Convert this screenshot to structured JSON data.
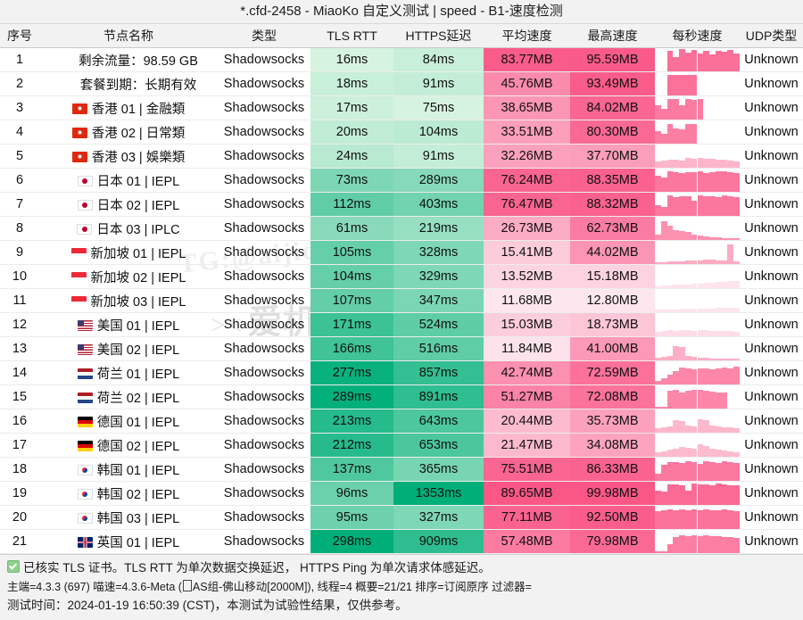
{
  "window": {
    "title": "*.cfd-2458 - MiaoKo 自定义测试 | speed - B1-速度检测"
  },
  "watermarks": {
    "text": "TG:@aijichang",
    "logo_mark": "><",
    "logo_text": "爱机场"
  },
  "table": {
    "columns": [
      {
        "key": "index",
        "label": "序号"
      },
      {
        "key": "name",
        "label": "节点名称"
      },
      {
        "key": "type",
        "label": "类型"
      },
      {
        "key": "tls",
        "label": "TLS RTT"
      },
      {
        "key": "https",
        "label": "HTTPS延迟"
      },
      {
        "key": "avg",
        "label": "平均速度"
      },
      {
        "key": "max",
        "label": "最高速度"
      },
      {
        "key": "spark",
        "label": "每秒速度"
      },
      {
        "key": "udp",
        "label": "UDP类型"
      }
    ],
    "rows": [
      {
        "index": "1",
        "flag": "none",
        "name": "剩余流量：98.59 GB",
        "type": "Shadowsocks",
        "tls": "16ms",
        "https": "84ms",
        "avg": "83.77MB",
        "max": "95.59MB",
        "udp": "Unknown",
        "tls_v": 16,
        "https_v": 84,
        "avg_v": 83.77,
        "max_v": 95.59,
        "spark": [
          0,
          0,
          88,
          62,
          95,
          80,
          92,
          78,
          88,
          72,
          90,
          85,
          92,
          78
        ]
      },
      {
        "index": "2",
        "flag": "none",
        "name": "套餐到期：长期有效",
        "type": "Shadowsocks",
        "tls": "18ms",
        "https": "91ms",
        "avg": "45.76MB",
        "max": "93.49MB",
        "udp": "Unknown",
        "tls_v": 18,
        "https_v": 91,
        "avg_v": 45.76,
        "max_v": 93.49,
        "spark": [
          0,
          0,
          90,
          90,
          90,
          90,
          90,
          0,
          0,
          0,
          0,
          0,
          0,
          0
        ]
      },
      {
        "index": "3",
        "flag": "hk",
        "name": "香港 01 | 金融類",
        "type": "Shadowsocks",
        "tls": "17ms",
        "https": "75ms",
        "avg": "38.65MB",
        "max": "84.02MB",
        "udp": "Unknown",
        "tls_v": 17,
        "https_v": 75,
        "avg_v": 38.65,
        "max_v": 84.02,
        "spark": [
          60,
          45,
          90,
          88,
          60,
          88,
          86,
          88,
          0,
          0,
          0,
          0,
          0,
          0
        ]
      },
      {
        "index": "4",
        "flag": "hk",
        "name": "香港 02 | 日常類",
        "type": "Shadowsocks",
        "tls": "20ms",
        "https": "104ms",
        "avg": "33.51MB",
        "max": "80.30MB",
        "udp": "Unknown",
        "tls_v": 20,
        "https_v": 104,
        "avg_v": 33.51,
        "max_v": 80.3,
        "spark": [
          55,
          42,
          86,
          64,
          60,
          86,
          84,
          0,
          0,
          0,
          0,
          0,
          0,
          0
        ]
      },
      {
        "index": "5",
        "flag": "hk",
        "name": "香港 03 | 娛樂類",
        "type": "Shadowsocks",
        "tls": "24ms",
        "https": "91ms",
        "avg": "32.26MB",
        "max": "37.70MB",
        "udp": "Unknown",
        "tls_v": 24,
        "https_v": 91,
        "avg_v": 32.26,
        "max_v": 37.7,
        "spark": [
          28,
          30,
          36,
          34,
          32,
          44,
          40,
          42,
          38,
          40,
          36,
          34,
          30,
          26
        ]
      },
      {
        "index": "6",
        "flag": "jp",
        "name": "日本 01 | IEPL",
        "type": "Shadowsocks",
        "tls": "73ms",
        "https": "289ms",
        "avg": "76.24MB",
        "max": "88.35MB",
        "udp": "Unknown",
        "tls_v": 73,
        "https_v": 289,
        "avg_v": 76.24,
        "max_v": 88.35,
        "spark": [
          68,
          62,
          88,
          84,
          80,
          86,
          84,
          88,
          82,
          86,
          90,
          88,
          84,
          80
        ]
      },
      {
        "index": "7",
        "flag": "jp",
        "name": "日本 02 | IEPL",
        "type": "Shadowsocks",
        "tls": "112ms",
        "https": "403ms",
        "avg": "76.47MB",
        "max": "88.32MB",
        "udp": "Unknown",
        "tls_v": 112,
        "https_v": 403,
        "avg_v": 76.47,
        "max_v": 88.32,
        "spark": [
          46,
          40,
          88,
          80,
          84,
          86,
          64,
          88,
          84,
          86,
          82,
          88,
          84,
          80
        ]
      },
      {
        "index": "8",
        "flag": "jp",
        "name": "日本 03 | IPLC",
        "type": "Shadowsocks",
        "tls": "61ms",
        "https": "219ms",
        "avg": "26.73MB",
        "max": "62.73MB",
        "udp": "Unknown",
        "tls_v": 61,
        "https_v": 219,
        "avg_v": 26.73,
        "max_v": 62.73,
        "spark": [
          22,
          80,
          62,
          42,
          38,
          34,
          24,
          20,
          16,
          12,
          10,
          8,
          6,
          4
        ]
      },
      {
        "index": "9",
        "flag": "sg",
        "name": "新加坡 01 | IEPL",
        "type": "Shadowsocks",
        "tls": "105ms",
        "https": "328ms",
        "avg": "15.41MB",
        "max": "44.02MB",
        "udp": "Unknown",
        "tls_v": 105,
        "https_v": 328,
        "avg_v": 15.41,
        "max_v": 44.02,
        "spark": [
          8,
          8,
          10,
          12,
          12,
          14,
          16,
          16,
          18,
          18,
          16,
          14,
          86,
          10
        ]
      },
      {
        "index": "10",
        "flag": "sg",
        "name": "新加坡 02 | IEPL",
        "type": "Shadowsocks",
        "tls": "104ms",
        "https": "329ms",
        "avg": "13.52MB",
        "max": "15.18MB",
        "udp": "Unknown",
        "tls_v": 104,
        "https_v": 329,
        "avg_v": 13.52,
        "max_v": 15.18,
        "spark": [
          8,
          10,
          12,
          14,
          16,
          16,
          18,
          20,
          22,
          24,
          26,
          28,
          30,
          30
        ]
      },
      {
        "index": "11",
        "flag": "sg",
        "name": "新加坡 03 | IEPL",
        "type": "Shadowsocks",
        "tls": "107ms",
        "https": "347ms",
        "avg": "11.68MB",
        "max": "12.80MB",
        "udp": "Unknown",
        "tls_v": 107,
        "https_v": 347,
        "avg_v": 11.68,
        "max_v": 12.8,
        "spark": [
          10,
          10,
          12,
          12,
          14,
          14,
          14,
          16,
          16,
          16,
          18,
          18,
          18,
          18
        ]
      },
      {
        "index": "12",
        "flag": "us",
        "name": "美国 01 | IEPL",
        "type": "Shadowsocks",
        "tls": "171ms",
        "https": "524ms",
        "avg": "15.03MB",
        "max": "18.73MB",
        "udp": "Unknown",
        "tls_v": 171,
        "https_v": 524,
        "avg_v": 15.03,
        "max_v": 18.73,
        "spark": [
          18,
          22,
          26,
          24,
          26,
          26,
          24,
          26,
          26,
          24,
          24,
          22,
          22,
          20
        ]
      },
      {
        "index": "13",
        "flag": "us",
        "name": "美国 02 | IEPL",
        "type": "Shadowsocks",
        "tls": "166ms",
        "https": "516ms",
        "avg": "11.84MB",
        "max": "41.00MB",
        "udp": "Unknown",
        "tls_v": 166,
        "https_v": 516,
        "avg_v": 11.84,
        "max_v": 41.0,
        "spark": [
          10,
          14,
          20,
          60,
          58,
          20,
          14,
          12,
          10,
          8,
          8,
          6,
          6,
          6
        ]
      },
      {
        "index": "14",
        "flag": "nl",
        "name": "荷兰 01 | IEPL",
        "type": "Shadowsocks",
        "tls": "277ms",
        "https": "857ms",
        "avg": "42.74MB",
        "max": "72.59MB",
        "udp": "Unknown",
        "tls_v": 277,
        "https_v": 857,
        "avg_v": 42.74,
        "max_v": 72.59,
        "spark": [
          16,
          26,
          44,
          56,
          72,
          70,
          66,
          70,
          68,
          66,
          70,
          74,
          70,
          78
        ]
      },
      {
        "index": "15",
        "flag": "nl",
        "name": "荷兰 02 | IEPL",
        "type": "Shadowsocks",
        "tls": "289ms",
        "https": "891ms",
        "avg": "51.27MB",
        "max": "72.08MB",
        "udp": "Unknown",
        "tls_v": 289,
        "https_v": 891,
        "avg_v": 51.27,
        "max_v": 72.08,
        "spark": [
          4,
          6,
          78,
          82,
          70,
          76,
          82,
          80,
          76,
          72,
          70,
          68,
          0,
          0
        ]
      },
      {
        "index": "16",
        "flag": "de",
        "name": "德国 01 | IEPL",
        "type": "Shadowsocks",
        "tls": "213ms",
        "https": "643ms",
        "avg": "20.44MB",
        "max": "35.73MB",
        "udp": "Unknown",
        "tls_v": 213,
        "https_v": 643,
        "avg_v": 20.44,
        "max_v": 35.73,
        "spark": [
          18,
          22,
          26,
          54,
          50,
          30,
          28,
          56,
          52,
          30,
          26,
          24,
          22,
          18
        ]
      },
      {
        "index": "17",
        "flag": "de",
        "name": "德国 02 | IEPL",
        "type": "Shadowsocks",
        "tls": "212ms",
        "https": "653ms",
        "avg": "21.47MB",
        "max": "34.08MB",
        "udp": "Unknown",
        "tls_v": 212,
        "https_v": 653,
        "avg_v": 21.47,
        "max_v": 34.08,
        "spark": [
          20,
          24,
          30,
          34,
          44,
          38,
          34,
          52,
          48,
          34,
          30,
          28,
          24,
          20
        ]
      },
      {
        "index": "18",
        "flag": "kr",
        "name": "韩国 01 | IEPL",
        "type": "Shadowsocks",
        "tls": "137ms",
        "https": "365ms",
        "avg": "75.51MB",
        "max": "86.33MB",
        "udp": "Unknown",
        "tls_v": 137,
        "https_v": 365,
        "avg_v": 75.51,
        "max_v": 86.33,
        "spark": [
          30,
          70,
          82,
          80,
          78,
          84,
          80,
          72,
          86,
          82,
          78,
          84,
          80,
          76
        ]
      },
      {
        "index": "19",
        "flag": "kr",
        "name": "韩国 02 | IEPL",
        "type": "Shadowsocks",
        "tls": "96ms",
        "https": "1353ms",
        "avg": "89.65MB",
        "max": "99.98MB",
        "udp": "Unknown",
        "tls_v": 96,
        "https_v": 1353,
        "avg_v": 89.65,
        "max_v": 99.98,
        "spark": [
          62,
          56,
          88,
          90,
          86,
          62,
          92,
          88,
          90,
          86,
          92,
          88,
          86,
          84
        ]
      },
      {
        "index": "20",
        "flag": "kr",
        "name": "韩国 03 | IEPL",
        "type": "Shadowsocks",
        "tls": "95ms",
        "https": "327ms",
        "avg": "77.11MB",
        "max": "92.50MB",
        "udp": "Unknown",
        "tls_v": 95,
        "https_v": 327,
        "avg_v": 77.11,
        "max_v": 92.5,
        "spark": [
          76,
          80,
          84,
          82,
          86,
          82,
          84,
          80,
          86,
          82,
          80,
          84,
          82,
          78
        ]
      },
      {
        "index": "21",
        "flag": "gb",
        "name": "英国 01 | IEPL",
        "type": "Shadowsocks",
        "tls": "298ms",
        "https": "909ms",
        "avg": "57.48MB",
        "max": "79.98MB",
        "udp": "Unknown",
        "tls_v": 298,
        "https_v": 909,
        "avg_v": 57.48,
        "max_v": 79.98,
        "spark": [
          4,
          4,
          40,
          68,
          76,
          74,
          78,
          74,
          76,
          72,
          74,
          70,
          68,
          64
        ]
      }
    ]
  },
  "footer": {
    "line1": "已核实 TLS 证书。TLS RTT 为单次数据交换延迟， HTTPS Ping 为单次请求体感延迟。",
    "line2_before": "主端=4.3.3 (697) 喵速=4.3.6-Meta (",
    "line2_after": "AS组-佛山移动[2000M]), 线程=4 概要=21/21 排序=订阅原序 过滤器=",
    "line3": "测试时间：2024-01-19 16:50:39 (CST)，本测试为试验性结果，仅供参考。"
  },
  "colors": {
    "green_light": "#d8f2e0",
    "green_dark": "#00b777",
    "pink_light": "#fde4ec",
    "pink_dark": "#fb5c8c",
    "spark_bar": "#fb6b95",
    "header_bg": "#f2f2f2"
  }
}
